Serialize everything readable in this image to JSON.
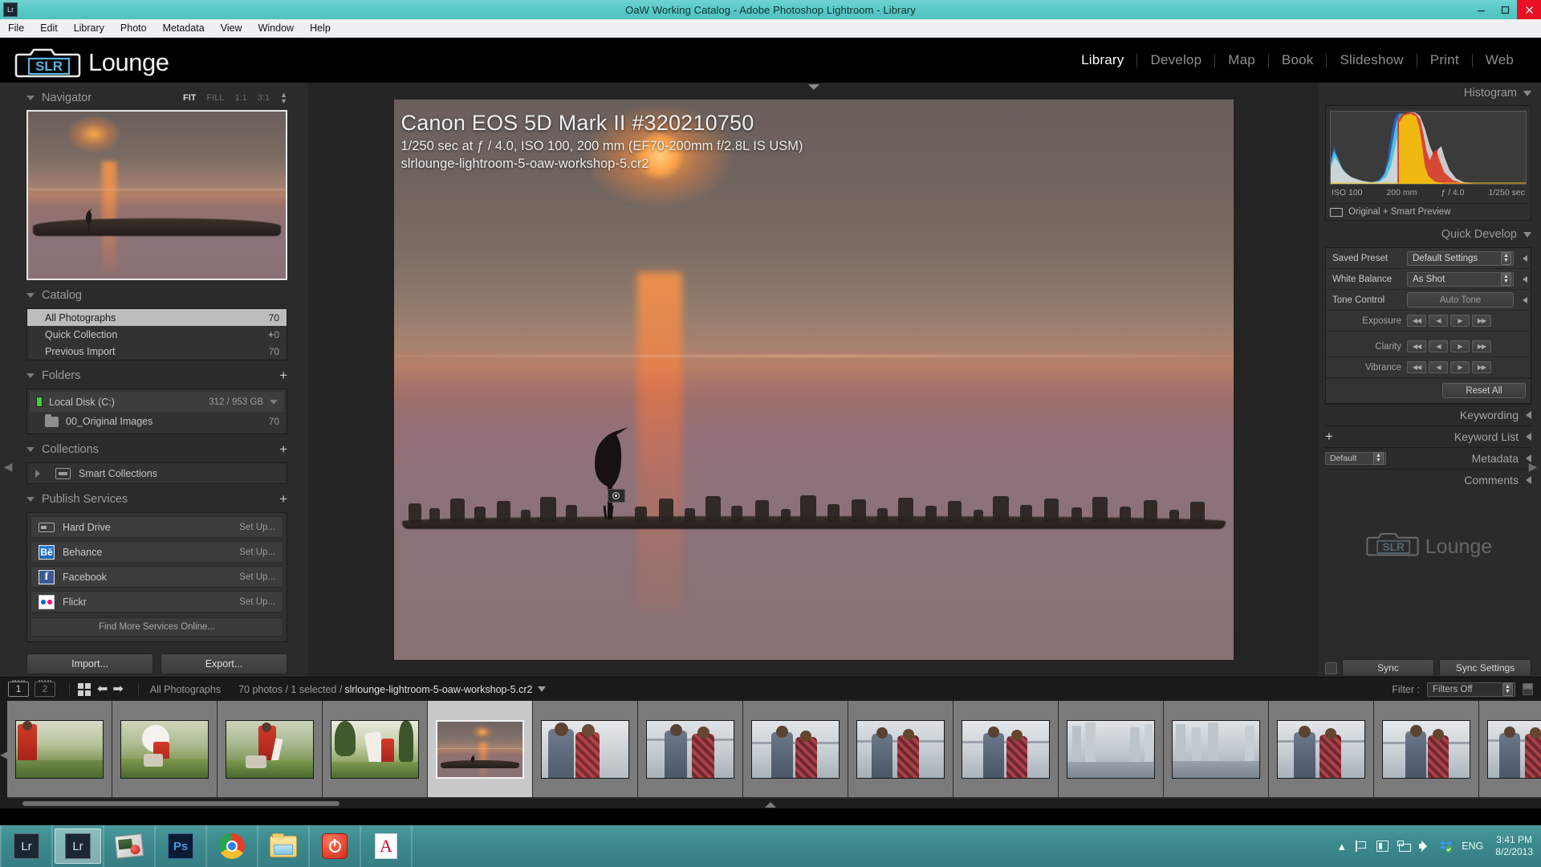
{
  "window": {
    "title": "OaW Working Catalog - Adobe Photoshop Lightroom - Library",
    "app_icon": "Lr",
    "minimize": "minimize-icon",
    "maximize": "maximize-icon",
    "close": "close-icon"
  },
  "menubar": [
    "File",
    "Edit",
    "Library",
    "Photo",
    "Metadata",
    "View",
    "Window",
    "Help"
  ],
  "identity": {
    "logo_mark": "SLR",
    "logo_text": "Lounge",
    "modules": [
      {
        "label": "Library",
        "active": true
      },
      {
        "label": "Develop",
        "active": false
      },
      {
        "label": "Map",
        "active": false
      },
      {
        "label": "Book",
        "active": false
      },
      {
        "label": "Slideshow",
        "active": false
      },
      {
        "label": "Print",
        "active": false
      },
      {
        "label": "Web",
        "active": false
      }
    ]
  },
  "left_panel": {
    "navigator": {
      "title": "Navigator",
      "zoom_levels": [
        {
          "label": "FIT",
          "active": true
        },
        {
          "label": "FILL",
          "active": false
        },
        {
          "label": "1:1",
          "active": false
        },
        {
          "label": "3:1",
          "active": false
        }
      ]
    },
    "catalog": {
      "title": "Catalog",
      "items": [
        {
          "name": "All Photographs",
          "count": "70",
          "selected": true,
          "plus": ""
        },
        {
          "name": "Quick Collection",
          "count": "0",
          "selected": false,
          "plus": "+"
        },
        {
          "name": "Previous Import",
          "count": "70",
          "selected": false,
          "plus": ""
        }
      ]
    },
    "folders": {
      "title": "Folders",
      "drive": {
        "name": "Local Disk (C:)",
        "space": "312 / 953 GB"
      },
      "children": [
        {
          "name": "00_Original Images",
          "count": "70"
        }
      ]
    },
    "collections": {
      "title": "Collections",
      "items": [
        {
          "name": "Smart Collections"
        }
      ]
    },
    "publish_services": {
      "title": "Publish Services",
      "items": [
        {
          "name": "Hard Drive",
          "action": "Set Up...",
          "icon": "harddrive-icon"
        },
        {
          "name": "Behance",
          "action": "Set Up...",
          "icon": "behance-icon",
          "glyph": "Bē"
        },
        {
          "name": "Facebook",
          "action": "Set Up...",
          "icon": "facebook-icon",
          "glyph": "f"
        },
        {
          "name": "Flickr",
          "action": "Set Up...",
          "icon": "flickr-icon"
        }
      ],
      "find_more": "Find More Services Online..."
    },
    "buttons": {
      "import": "Import...",
      "export": "Export..."
    }
  },
  "photo_overlay": {
    "line1": "Canon EOS 5D Mark II #320210750",
    "line2": "1/250 sec at ƒ / 4.0, ISO 100, 200 mm (EF70-200mm f/2.8L IS USM)",
    "line3": "slrlounge-lightroom-5-oaw-workshop-5.cr2"
  },
  "right_panel": {
    "histogram": {
      "title": "Histogram",
      "iso": "ISO 100",
      "focal": "200 mm",
      "aperture": "ƒ / 4.0",
      "shutter": "1/250 sec",
      "preview_status": "Original + Smart Preview"
    },
    "quick_develop": {
      "title": "Quick Develop",
      "saved_preset_label": "Saved Preset",
      "saved_preset_value": "Default Settings",
      "white_balance_label": "White Balance",
      "white_balance_value": "As Shot",
      "tone_control_label": "Tone Control",
      "auto_tone": "Auto Tone",
      "sliders": [
        "Exposure",
        "Clarity",
        "Vibrance"
      ],
      "reset_all": "Reset All"
    },
    "sections": [
      {
        "title": "Keywording",
        "lead": ""
      },
      {
        "title": "Keyword List",
        "lead": "+"
      },
      {
        "title": "Metadata",
        "lead": "Default"
      },
      {
        "title": "Comments",
        "lead": ""
      }
    ],
    "watermark_mark": "SLR",
    "watermark_text": "Lounge",
    "sync": "Sync",
    "sync_settings": "Sync Settings"
  },
  "filmstrip_toolbar": {
    "monitor_1": "1",
    "monitor_2": "2",
    "grid_icon": "grid-view-icon",
    "back_icon": "back-arrow-icon",
    "forward_icon": "forward-arrow-icon",
    "source": "All Photographs",
    "count": "70 photos / 1 selected /",
    "filename": "slrlounge-lightroom-5-oaw-workshop-5.cr2",
    "filter_label": "Filter :",
    "filter_value": "Filters Off"
  },
  "filmstrip": {
    "thumbnails": [
      {
        "id": 1,
        "kind": "garden-red-dress",
        "selected": false
      },
      {
        "id": 2,
        "kind": "garden-parasol",
        "selected": false
      },
      {
        "id": 3,
        "kind": "garden-fountain",
        "selected": false
      },
      {
        "id": 4,
        "kind": "garden-arch",
        "selected": false
      },
      {
        "id": 5,
        "kind": "sunset-heron",
        "selected": true
      },
      {
        "id": 6,
        "kind": "couple-bridge",
        "selected": false
      },
      {
        "id": 7,
        "kind": "couple-city-a",
        "selected": false
      },
      {
        "id": 8,
        "kind": "couple-city-b",
        "selected": false
      },
      {
        "id": 9,
        "kind": "couple-city-c",
        "selected": false
      },
      {
        "id": 10,
        "kind": "couple-city-d",
        "selected": false
      },
      {
        "id": 11,
        "kind": "couple-city-e",
        "selected": false
      },
      {
        "id": 12,
        "kind": "couple-city-f",
        "selected": false
      },
      {
        "id": 13,
        "kind": "couple-city-g",
        "selected": false
      },
      {
        "id": 14,
        "kind": "couple-city-h",
        "selected": false
      },
      {
        "id": 15,
        "kind": "couple-city-i",
        "selected": false
      }
    ]
  },
  "taskbar": {
    "items": [
      {
        "name": "lightroom-pinned",
        "icon": "lr-icon",
        "label": "Lr",
        "active": false
      },
      {
        "name": "lightroom-running",
        "icon": "lr-icon",
        "label": "Lr",
        "active": true
      },
      {
        "name": "photo-viewer",
        "icon": "photo-icon",
        "label": "",
        "active": false
      },
      {
        "name": "photoshop",
        "icon": "ps-icon",
        "label": "Ps",
        "active": false
      },
      {
        "name": "chrome",
        "icon": "chrome-icon",
        "label": "",
        "active": false
      },
      {
        "name": "file-explorer",
        "icon": "folder-icon",
        "label": "",
        "active": false
      },
      {
        "name": "power-utility",
        "icon": "power-icon",
        "label": "",
        "active": false
      },
      {
        "name": "acrobat-reader",
        "icon": "acrobat-icon",
        "label": "A",
        "active": false
      }
    ],
    "tray": {
      "show_hidden": "chevron-up-icon",
      "action_center": "flag-icon",
      "battery": "battery-icon",
      "network": "network-icon",
      "volume": "volume-icon",
      "dropbox": "dropbox-icon",
      "language": "ENG",
      "time": "3:41 PM",
      "date": "8/2/2013"
    }
  },
  "colors": {
    "titlebar": "#57c9c6",
    "panel_bg": "#2b2b2b",
    "center_bg": "#242424",
    "accent_blue": "#2b7fd4",
    "taskbar": "#3c8a8e",
    "selected_row": "#bdbdbd"
  }
}
